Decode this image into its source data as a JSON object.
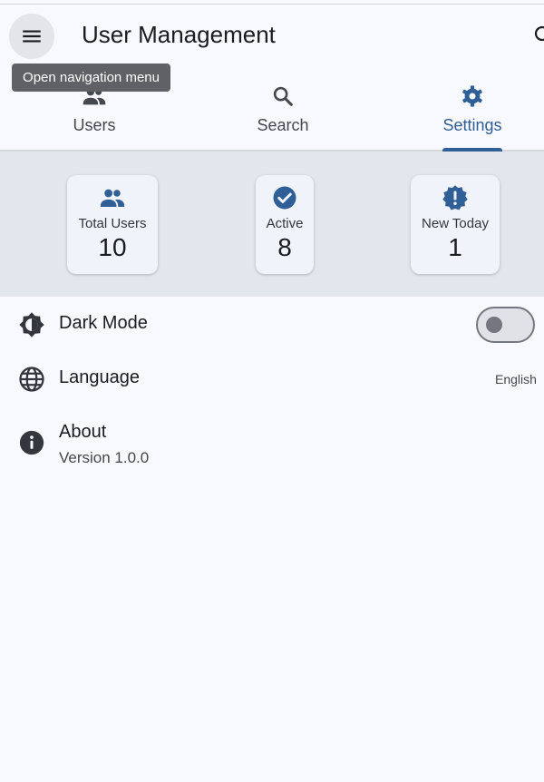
{
  "appbar": {
    "title": "User Management",
    "menu_icon": "menu-icon",
    "search_icon": "search-icon",
    "tooltip": "Open navigation menu"
  },
  "tabs": [
    {
      "label": "Users",
      "icon": "people-icon",
      "active": false
    },
    {
      "label": "Search",
      "icon": "search-icon",
      "active": false
    },
    {
      "label": "Settings",
      "icon": "gear-icon",
      "active": true
    }
  ],
  "stats": [
    {
      "label": "Total Users",
      "value": "10",
      "icon": "people-icon"
    },
    {
      "label": "Active",
      "value": "8",
      "icon": "check-circle-icon"
    },
    {
      "label": "New Today",
      "value": "1",
      "icon": "new-releases-icon"
    }
  ],
  "settings": {
    "dark_mode": {
      "title": "Dark Mode",
      "icon": "brightness-icon",
      "enabled": false
    },
    "language": {
      "title": "Language",
      "icon": "globe-icon",
      "value": "English"
    },
    "about": {
      "title": "About",
      "icon": "info-icon",
      "subtitle": "Version 1.0.0"
    }
  },
  "colors": {
    "accent": "#2f5f96",
    "background": "#f8f9ff",
    "stats_band": "#e2e7ee",
    "card": "#f1f3fb",
    "tooltip_bg": "#5f6166"
  }
}
